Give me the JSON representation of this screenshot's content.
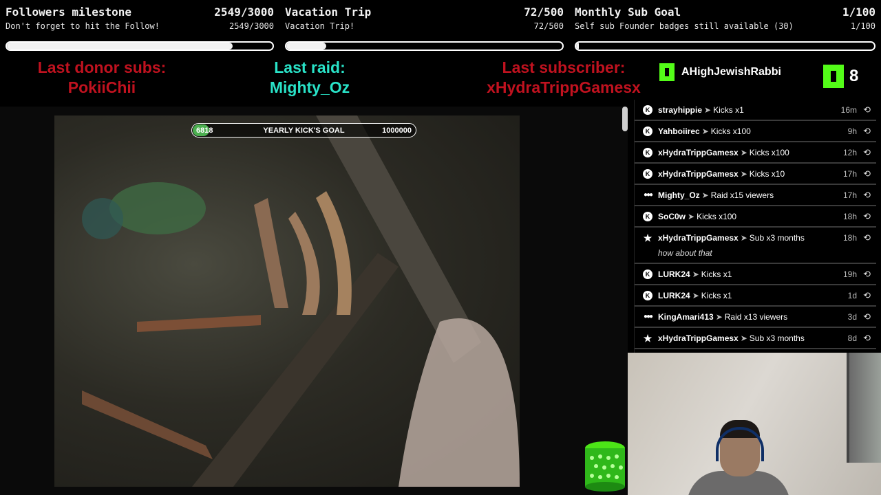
{
  "goals": [
    {
      "title": "Followers milestone",
      "subtitle": "Don't forget to hit the Follow!",
      "progress_text": "2549/3000",
      "progress_text_2": "2549/3000",
      "progress": 0.85
    },
    {
      "title": "Vacation Trip",
      "subtitle": "Vacation Trip!",
      "progress_text": "72/500",
      "progress_text_2": "72/500",
      "progress": 0.144
    },
    {
      "title": "Monthly Sub Goal",
      "subtitle": "Self sub Founder badges still available (30)",
      "progress_text": "1/100",
      "progress_text_2": "1/100",
      "progress": 0.01
    }
  ],
  "last_labels": {
    "donor_label": "Last donor subs:",
    "donor_value": "PokiiChii",
    "raid_label": "Last raid:",
    "raid_value": "Mighty_Oz",
    "sub_label": "Last subscriber:",
    "sub_value": "xHydraTrippGamesx"
  },
  "kick_user": {
    "name": "AHighJewishRabbi",
    "count": "8"
  },
  "kick_goal": {
    "current": "6818",
    "title": "YEARLY KICK'S GOAL",
    "target": "1000000",
    "progress": 0.0068
  },
  "feed": [
    {
      "icon": "kick-icon",
      "user": "strayhippie",
      "action": "Kicks x1",
      "time": "16m"
    },
    {
      "icon": "kick-icon",
      "user": "Yahboiirec",
      "action": "Kicks x100",
      "time": "9h"
    },
    {
      "icon": "kick-icon",
      "user": "xHydraTrippGamesx",
      "action": "Kicks x100",
      "time": "12h"
    },
    {
      "icon": "kick-icon",
      "user": "xHydraTrippGamesx",
      "action": "Kicks x10",
      "time": "17h"
    },
    {
      "icon": "raid-icon",
      "user": "Mighty_Oz",
      "action": "Raid x15 viewers",
      "time": "17h"
    },
    {
      "icon": "kick-icon",
      "user": "SoC0w",
      "action": "Kicks x100",
      "time": "18h"
    },
    {
      "icon": "star-icon",
      "user": "xHydraTrippGamesx",
      "action": "Sub x3 months",
      "time": "18h",
      "message": "how about that"
    },
    {
      "icon": "kick-icon",
      "user": "LURK24",
      "action": "Kicks x1",
      "time": "19h"
    },
    {
      "icon": "kick-icon",
      "user": "LURK24",
      "action": "Kicks x1",
      "time": "1d"
    },
    {
      "icon": "raid-icon",
      "user": "KingAmari413",
      "action": "Raid x13 viewers",
      "time": "3d"
    },
    {
      "icon": "star-icon",
      "user": "xHydraTrippGamesx",
      "action": "Sub x3 months",
      "time": "8d"
    }
  ],
  "colors": {
    "red": "#c0121f",
    "cyan": "#29e3c8",
    "kick_green": "#53fc18"
  }
}
